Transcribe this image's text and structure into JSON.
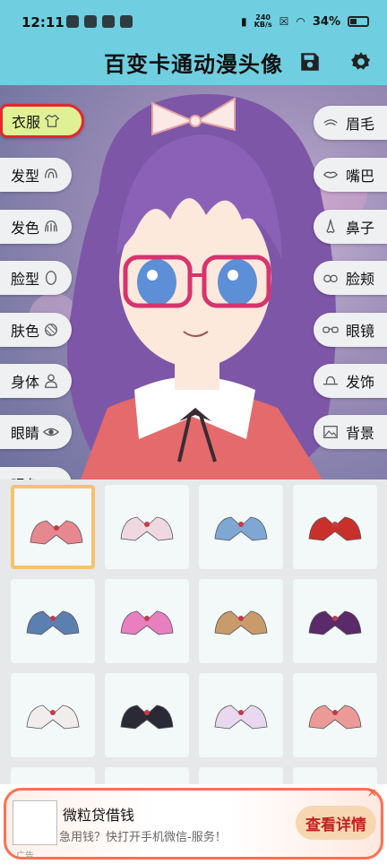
{
  "status_bar": {
    "time": "12:11",
    "speed_value": "240",
    "speed_unit": "KB/s",
    "battery": "34%"
  },
  "header": {
    "title": "百变卡通动漫头像",
    "save_icon": "save-icon",
    "settings_icon": "gear-icon",
    "bg_color": "#6fcfe0"
  },
  "left_tools": [
    {
      "label": "衣服",
      "icon": "shirt-icon",
      "active": true
    },
    {
      "label": "发型",
      "icon": "hair-icon"
    },
    {
      "label": "发色",
      "icon": "hair-color-icon"
    },
    {
      "label": "脸型",
      "icon": "face-icon"
    },
    {
      "label": "肤色",
      "icon": "skin-icon"
    },
    {
      "label": "身体",
      "icon": "person-icon"
    },
    {
      "label": "眼睛",
      "icon": "eye-icon"
    },
    {
      "label": "眼色",
      "icon": "eye-color-icon"
    }
  ],
  "right_tools": [
    {
      "label": "眉毛",
      "icon": "eyebrow-icon"
    },
    {
      "label": "嘴巴",
      "icon": "mouth-icon"
    },
    {
      "label": "鼻子",
      "icon": "nose-icon"
    },
    {
      "label": "脸颊",
      "icon": "cheek-icon"
    },
    {
      "label": "眼镜",
      "icon": "glasses-icon"
    },
    {
      "label": "发饰",
      "icon": "hat-icon"
    },
    {
      "label": "背景",
      "icon": "image-icon"
    }
  ],
  "clothing_grid": {
    "selected_index": 0,
    "items": [
      {
        "name": "pink-sailor-collar",
        "color": "#e78790"
      },
      {
        "name": "white-pink-bow-collar",
        "color": "#f0d8e0"
      },
      {
        "name": "blue-collar",
        "color": "#7fa7d4"
      },
      {
        "name": "red-collar",
        "color": "#c9302c"
      },
      {
        "name": "blue-denim-collar",
        "color": "#5b7fb0"
      },
      {
        "name": "pink-ruffle-collar",
        "color": "#e77fc0"
      },
      {
        "name": "brown-strap-collar",
        "color": "#c99b6b"
      },
      {
        "name": "purple-jeweled-collar",
        "color": "#5a2a6a"
      },
      {
        "name": "white-red-bow-collar",
        "color": "#f2eded"
      },
      {
        "name": "black-sailor-collar",
        "color": "#2a2a36"
      },
      {
        "name": "white-lace-collar",
        "color": "#e9d8ef"
      },
      {
        "name": "salmon-collar",
        "color": "#ec9a98"
      }
    ]
  },
  "ad": {
    "title": "微粒贷借钱",
    "description": "急用钱？快打开手机微信-服务！",
    "cta": "查看详情",
    "tag": "广告",
    "close": "✕",
    "accent": "#ff6f52"
  }
}
